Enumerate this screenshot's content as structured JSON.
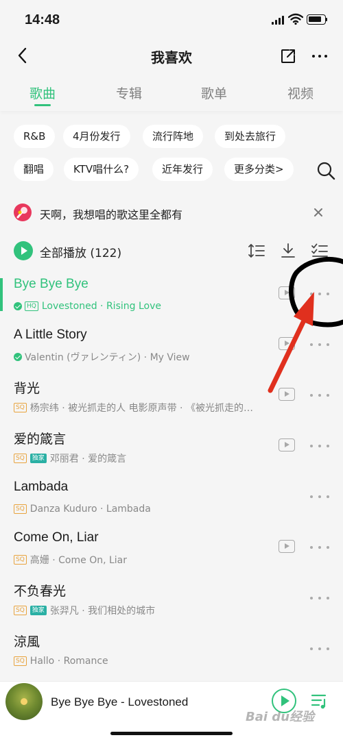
{
  "status_bar": {
    "time": "14:48"
  },
  "nav": {
    "title": "我喜欢"
  },
  "tabs": [
    {
      "label": "歌曲",
      "active": true
    },
    {
      "label": "专辑",
      "active": false
    },
    {
      "label": "歌单",
      "active": false
    },
    {
      "label": "视频",
      "active": false
    }
  ],
  "chips": [
    "R&B",
    "4月份发行",
    "流行阵地",
    "到处去旅行",
    "翻唱",
    "KTV唱什么?",
    "近年发行",
    "更多分类>"
  ],
  "banner": {
    "text": "天啊，我想唱的歌这里全都有"
  },
  "play_all": {
    "label": "全部播放 (122)"
  },
  "songs": [
    {
      "title": "Bye Bye Bye",
      "badges": [
        "check",
        "HQ"
      ],
      "meta": "Lovestoned · Rising Love",
      "has_mv": true,
      "playing": true
    },
    {
      "title": "A Little Story",
      "badges": [
        "check"
      ],
      "meta": "Valentin (ヴァレンティン) · My View",
      "has_mv": true,
      "playing": false
    },
    {
      "title": "背光",
      "badges": [
        "SQ"
      ],
      "meta": "杨宗纬 · 被光抓走的人 电影原声带 · 《被光抓走的…",
      "has_mv": true,
      "playing": false
    },
    {
      "title": "爱的箴言",
      "badges": [
        "SQ",
        "独家"
      ],
      "meta": "邓丽君 · 爱的箴言",
      "has_mv": true,
      "playing": false
    },
    {
      "title": "Lambada",
      "badges": [
        "SQ"
      ],
      "meta": "Danza Kuduro · Lambada",
      "has_mv": false,
      "playing": false
    },
    {
      "title": "Come On, Liar",
      "badges": [
        "SQ"
      ],
      "meta": "高姗 · Come On, Liar",
      "has_mv": true,
      "playing": false
    },
    {
      "title": "不负春光",
      "badges": [
        "SQ",
        "独家"
      ],
      "meta": "张羿凡 · 我们相处的城市",
      "has_mv": false,
      "playing": false
    },
    {
      "title": "涼風",
      "badges": [
        "SQ"
      ],
      "meta": "Hallo · Romance",
      "has_mv": false,
      "playing": false
    }
  ],
  "mini_player": {
    "now_playing": "Bye Bye Bye - Lovestoned"
  },
  "watermark": "Bai du经验",
  "colors": {
    "accent": "#31c27c",
    "badge_sq": "#e8a33d",
    "annotation": "#e0301e"
  },
  "icons": [
    "back-arrow-icon",
    "share-icon",
    "more-icon",
    "search-icon",
    "close-icon",
    "play-icon",
    "sort-icon",
    "download-icon",
    "multi-select-icon",
    "mv-icon",
    "playlist-icon"
  ]
}
